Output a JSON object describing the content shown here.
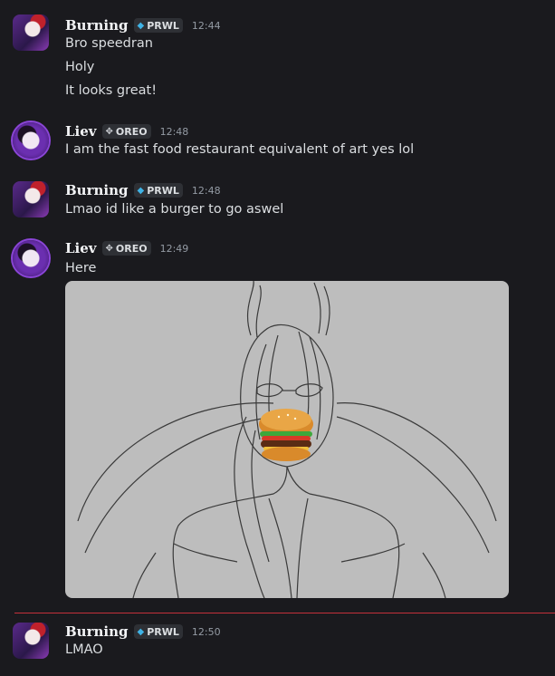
{
  "messages": [
    {
      "author": "Burning",
      "tag": "PRWL",
      "tag_icon": "crystal-icon",
      "time": "12:44",
      "lines": [
        "Bro speedran",
        "Holy",
        "It looks great!"
      ]
    },
    {
      "author": "Liev",
      "tag": "OREO",
      "tag_icon": "dpad-icon",
      "time": "12:48",
      "lines": [
        "I am the fast food restaurant equivalent of art yes lol"
      ]
    },
    {
      "author": "Burning",
      "tag": "PRWL",
      "tag_icon": "crystal-icon",
      "time": "12:48",
      "lines": [
        "Lmao id like a burger to go aswel"
      ]
    },
    {
      "author": "Liev",
      "tag": "OREO",
      "tag_icon": "dpad-icon",
      "time": "12:49",
      "lines": [
        "Here"
      ],
      "attachment": "sketch-image-with-burger"
    },
    {
      "author": "Burning",
      "tag": "PRWL",
      "tag_icon": "crystal-icon",
      "time": "12:50",
      "lines": [
        "LMAO"
      ]
    }
  ],
  "colors": {
    "background": "#1a1a1e",
    "new_message_divider": "#c5303a",
    "prwl_icon": "#3fb3e6"
  }
}
